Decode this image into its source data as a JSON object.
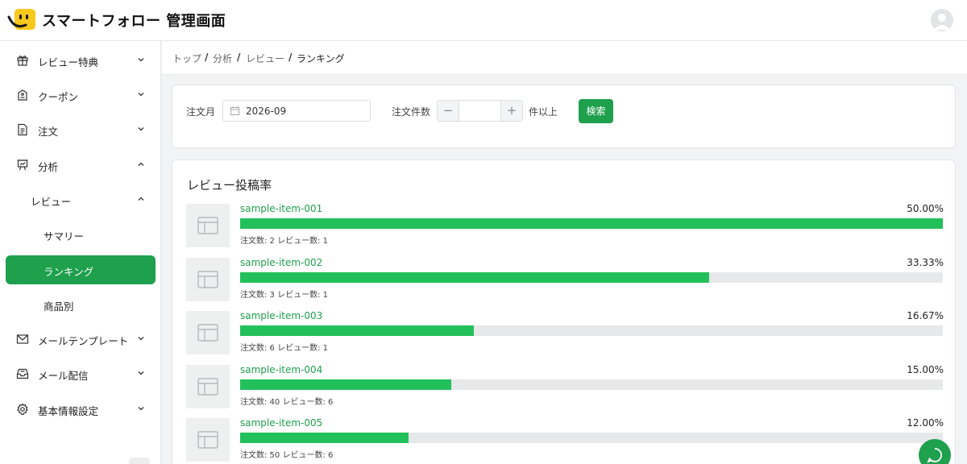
{
  "app": {
    "title": "スマートフォロー 管理画面"
  },
  "colors": {
    "accent": "#1ea04d",
    "bar": "#22c05a",
    "bar_track": "#e6e8ea",
    "logo_yellow": "#f8c81c"
  },
  "sidebar": {
    "items": [
      {
        "label": "レビュー特典",
        "icon": "gift-icon",
        "expanded": false
      },
      {
        "label": "クーポン",
        "icon": "coupon-icon",
        "expanded": false
      },
      {
        "label": "注文",
        "icon": "document-icon",
        "expanded": false
      },
      {
        "label": "分析",
        "icon": "presentation-chart-icon",
        "expanded": true
      },
      {
        "label": "レビュー",
        "expanded": true
      },
      {
        "label": "サマリー"
      },
      {
        "label": "ランキング",
        "active": true
      },
      {
        "label": "商品別"
      },
      {
        "label": "メールテンプレート",
        "icon": "mail-icon",
        "expanded": false
      },
      {
        "label": "メール配信",
        "icon": "inbox-icon",
        "expanded": false
      },
      {
        "label": "基本情報設定",
        "icon": "gear-icon",
        "expanded": false
      }
    ]
  },
  "breadcrumb": {
    "items": [
      "トップ",
      "分析",
      "レビュー",
      "ランキング"
    ],
    "separator": "/"
  },
  "filters": {
    "month_label": "注文月",
    "month_value": "2026-09",
    "count_label": "注文件数",
    "count_value": "",
    "count_suffix": "件以上",
    "minus": "−",
    "plus": "+",
    "search_label": "検索"
  },
  "ranking": {
    "title": "レビュー投稿率",
    "items": [
      {
        "name": "sample-item-001",
        "rate": "50.00%",
        "fill_percent": 100,
        "counts": "注文数: 2 レビュー数: 1"
      },
      {
        "name": "sample-item-002",
        "rate": "33.33%",
        "fill_percent": 66.7,
        "counts": "注文数: 3 レビュー数: 1"
      },
      {
        "name": "sample-item-003",
        "rate": "16.67%",
        "fill_percent": 33.3,
        "counts": "注文数: 6 レビュー数: 1"
      },
      {
        "name": "sample-item-004",
        "rate": "15.00%",
        "fill_percent": 30,
        "counts": "注文数: 40 レビュー数: 6"
      },
      {
        "name": "sample-item-005",
        "rate": "12.00%",
        "fill_percent": 24,
        "counts": "注文数: 50 レビュー数: 6"
      }
    ]
  }
}
